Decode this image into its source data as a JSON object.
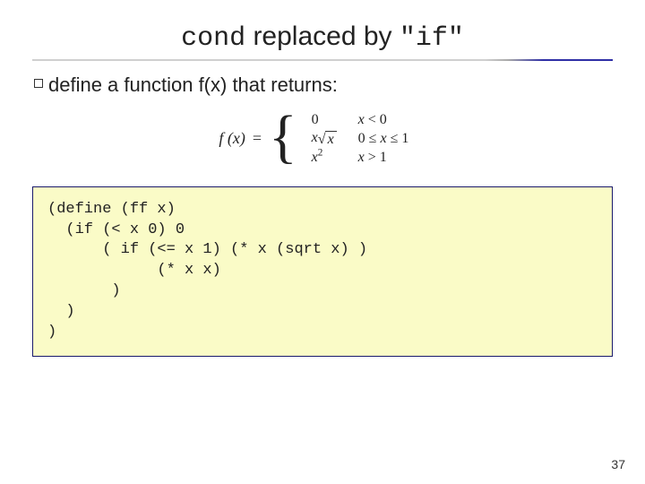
{
  "title": {
    "part1": "cond",
    "part2": " replaced by ",
    "part3": "\"if\""
  },
  "bullet": "define a function f(x) that returns:",
  "equation": {
    "lhs": "f (x) =",
    "cases": [
      {
        "expr_plain": "0",
        "cond": "x < 0"
      },
      {
        "expr_tex": "x\\sqrt{x}",
        "cond": "0 ≤ x ≤ 1"
      },
      {
        "expr_tex": "x^{2}",
        "cond": "x > 1"
      }
    ]
  },
  "code_lines": [
    "(define (ff x)",
    "  (if (< x 0) 0",
    "      ( if (<= x 1) (* x (sqrt x) )",
    "            (* x x)",
    "       )",
    "  )",
    ")"
  ],
  "page_number": "37",
  "chart_data": null
}
